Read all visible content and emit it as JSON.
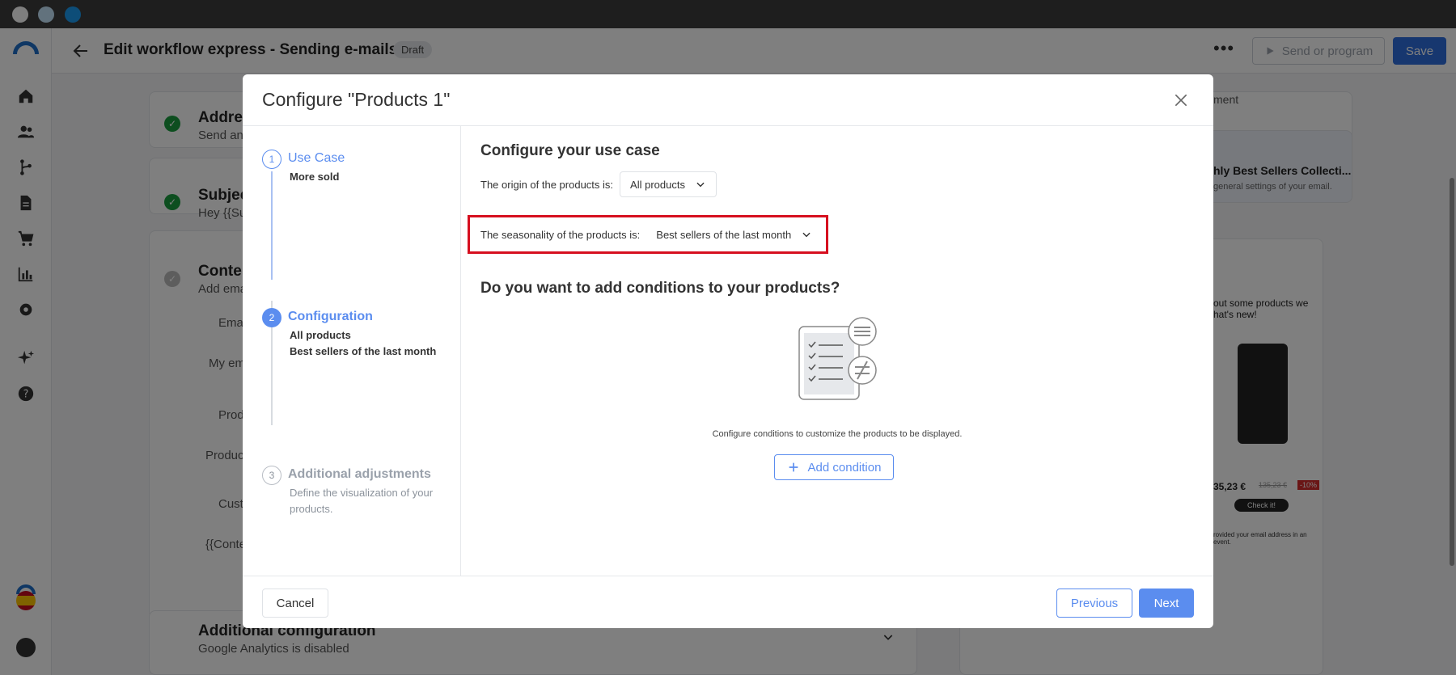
{
  "app": {
    "title": "Edit workflow express - Sending e-mails",
    "status_badge": "Draft",
    "more_label": "•••",
    "send_label": "Send or program",
    "save_label": "Save"
  },
  "background": {
    "address": {
      "title": "Addres",
      "sub": "Send an"
    },
    "subject": {
      "title": "Subjec",
      "sub": "Hey {{Su"
    },
    "content": {
      "title": "Conten",
      "sub": "Add ema"
    },
    "email_row": "Emai",
    "my_email": "My ema",
    "products_row": "Prod",
    "product_item": "Product",
    "custom_row": "Custo",
    "content_var": "{{Conte",
    "additional": {
      "title": "Additional configuration",
      "sub": "Google Analytics is disabled"
    },
    "right_tab": "ment",
    "right_card_title": "hly Best Sellers Collecti...",
    "right_card_sub": "general settings of your email.",
    "preview_text": "out some products we\nhat's new!",
    "preview_price": "35,23 €",
    "preview_old_price": "135,23 €",
    "preview_discount": "-10%",
    "preview_cta": "Check it!",
    "preview_footer": "rovided your email address in an event."
  },
  "modal": {
    "title": "Configure \"Products 1\"",
    "steps": [
      {
        "num": "1",
        "title": "Use Case",
        "desc": [
          "More sold"
        ]
      },
      {
        "num": "2",
        "title": "Configuration",
        "desc": [
          "All products",
          "Best sellers of the last month"
        ]
      },
      {
        "num": "3",
        "title": "Additional adjustments",
        "desc": [
          "Define the visualization of your products."
        ]
      }
    ],
    "configure_heading": "Configure your use case",
    "origin_label": "The origin of the products is:",
    "origin_value": "All products",
    "seasonality_label": "The seasonality of the products is:",
    "seasonality_value": "Best sellers of the last month",
    "conditions_heading": "Do you want to add conditions to your products?",
    "conditions_help": "Configure conditions to customize the products to be displayed.",
    "add_condition_label": "Add condition",
    "cancel_label": "Cancel",
    "previous_label": "Previous",
    "next_label": "Next"
  },
  "colors": {
    "primary": "#5b8def",
    "highlight": "#d60f1f",
    "save": "#2f6fde"
  }
}
